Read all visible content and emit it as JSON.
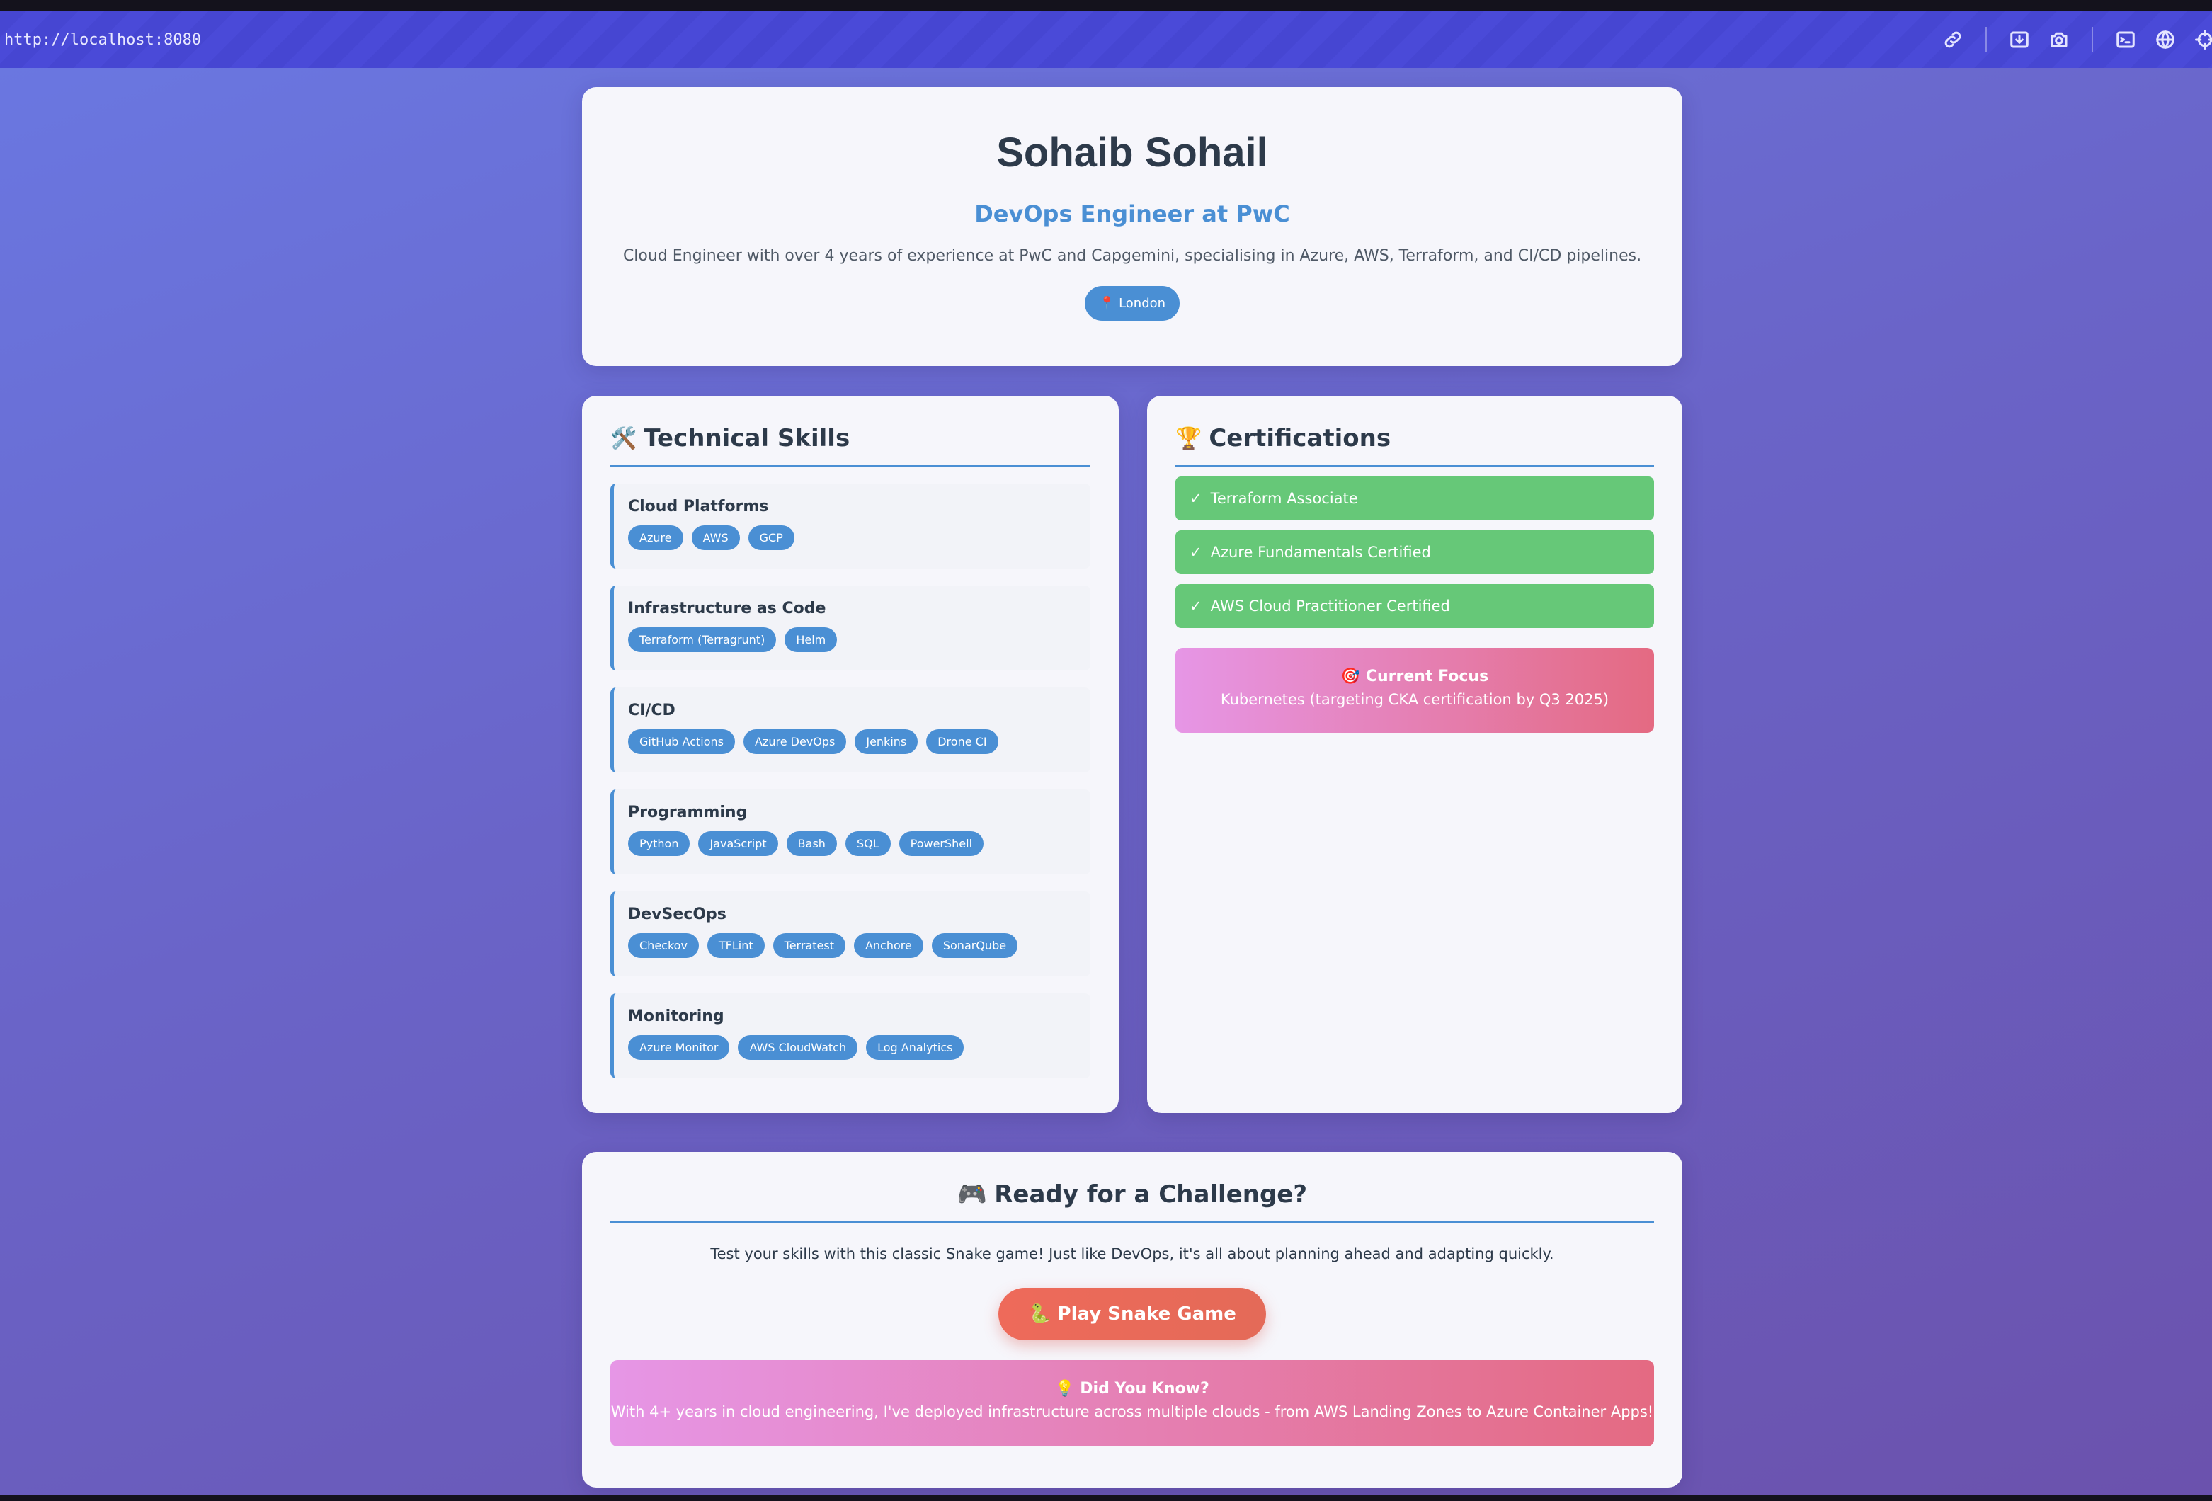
{
  "browser": {
    "url": "http://localhost:8080",
    "toolbar_icons": [
      "link-icon",
      "download-icon",
      "camera-icon",
      "terminal-icon",
      "globe-icon",
      "crosshair-icon"
    ]
  },
  "header": {
    "name": "Sohaib Sohail",
    "role": "DevOps Engineer at PwC",
    "summary": "Cloud Engineer with over 4 years of experience at PwC and Capgemini, specialising in Azure, AWS, Terraform, and CI/CD pipelines.",
    "location": "📍 London"
  },
  "skills": {
    "icon": "🛠️",
    "title": "Technical Skills",
    "groups": [
      {
        "name": "Cloud Platforms",
        "tags": [
          "Azure",
          "AWS",
          "GCP"
        ]
      },
      {
        "name": "Infrastructure as Code",
        "tags": [
          "Terraform (Terragrunt)",
          "Helm"
        ]
      },
      {
        "name": "CI/CD",
        "tags": [
          "GitHub Actions",
          "Azure DevOps",
          "Jenkins",
          "Drone CI"
        ]
      },
      {
        "name": "Programming",
        "tags": [
          "Python",
          "JavaScript",
          "Bash",
          "SQL",
          "PowerShell"
        ]
      },
      {
        "name": "DevSecOps",
        "tags": [
          "Checkov",
          "TFLint",
          "Terratest",
          "Anchore",
          "SonarQube"
        ]
      },
      {
        "name": "Monitoring",
        "tags": [
          "Azure Monitor",
          "AWS CloudWatch",
          "Log Analytics"
        ]
      }
    ]
  },
  "certifications": {
    "icon": "🏆",
    "title": "Certifications",
    "check": "✓",
    "items": [
      "Terraform Associate",
      "Azure Fundamentals Certified",
      "AWS Cloud Practitioner Certified"
    ],
    "focus_title": "🎯 Current Focus",
    "focus_text": "Kubernetes (targeting CKA certification by Q3 2025)"
  },
  "game": {
    "icon": "🎮",
    "title": "Ready for a Challenge?",
    "description": "Test your skills with this classic Snake game! Just like DevOps, it's all about planning ahead and adapting quickly.",
    "button_label": "🐍 Play Snake Game",
    "did_you_know_title": "💡 Did You Know?",
    "did_you_know_text": "With 4+ years in cloud engineering, I've deployed infrastructure across multiple clouds - from AWS Landing Zones to Azure Container Apps!"
  },
  "colors": {
    "accent": "#4a8fd4",
    "cert_green": "#66c878",
    "heading": "#2d3a4a",
    "background_start": "#6a78e2",
    "background_end": "#6b52ad"
  }
}
